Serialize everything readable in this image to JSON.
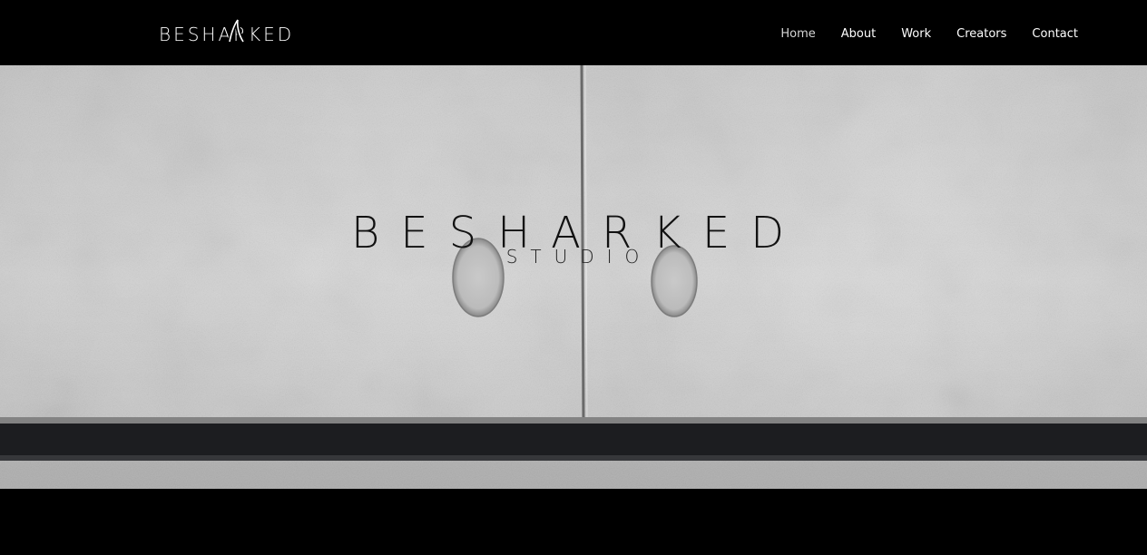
{
  "header": {
    "logo_text": "BESHARKED",
    "nav": [
      {
        "label": "Home",
        "active": true
      },
      {
        "label": "About",
        "active": false
      },
      {
        "label": "Work",
        "active": false
      },
      {
        "label": "Creators",
        "active": false
      },
      {
        "label": "Contact",
        "active": false
      }
    ]
  },
  "hero": {
    "title": "BESHARKED",
    "subtitle": "STUDIO",
    "background": "concrete-wall-photo"
  },
  "colors": {
    "header_bg": "#000000",
    "nav_text": "#ffffff",
    "hero_text": "#111111",
    "concrete": "#d2d2d2"
  }
}
